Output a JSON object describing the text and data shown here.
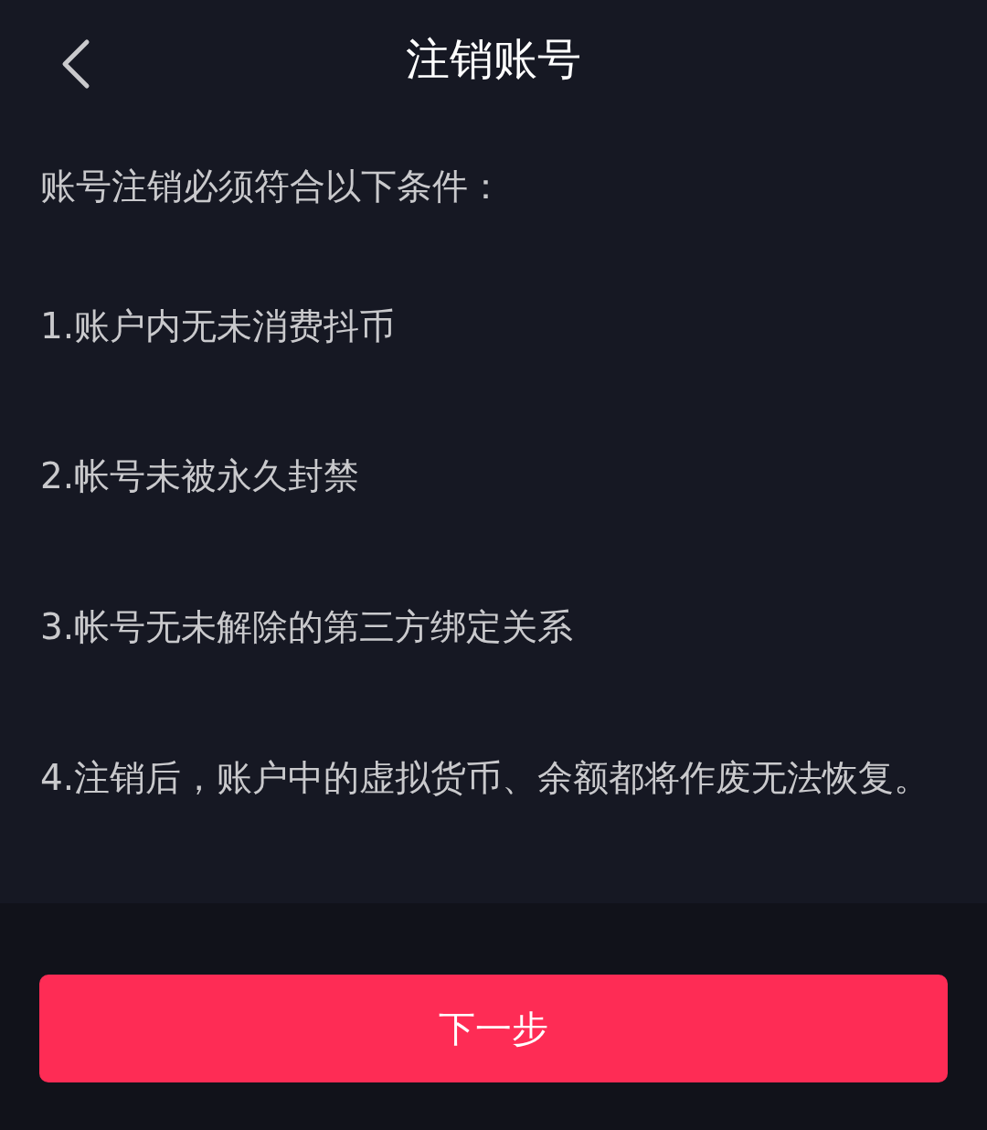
{
  "header": {
    "title": "注销账号"
  },
  "intro": "账号注销必须符合以下条件：",
  "conditions": [
    "1.账户内无未消费抖币",
    "2.帐号未被永久封禁",
    "3.帐号无未解除的第三方绑定关系",
    "4.注销后，账户中的虚拟货币、余额都将作废无法恢复。"
  ],
  "next_button": {
    "label": "下一步"
  }
}
